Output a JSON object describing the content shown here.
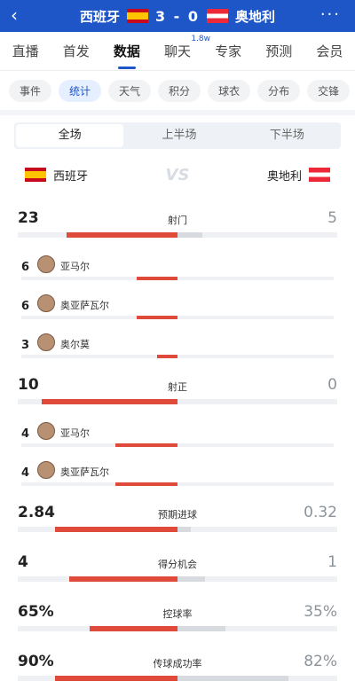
{
  "header": {
    "home_team": "西班牙",
    "away_team": "奥地利",
    "score": "3 - 0",
    "more": "···"
  },
  "tabs": [
    "直播",
    "首发",
    "数据",
    "聊天",
    "专家",
    "预测",
    "会员"
  ],
  "chat_badge": "1.8w",
  "chips": [
    "事件",
    "统计",
    "天气",
    "积分",
    "球衣",
    "分布",
    "交锋"
  ],
  "segments": [
    "全场",
    "上半场",
    "下半场"
  ],
  "teams": {
    "left": "西班牙",
    "right": "奥地利",
    "vs": "VS"
  },
  "stats": [
    {
      "label": "射门",
      "left": "23",
      "right": "5",
      "lpct": 0.82,
      "rpct": 0.18
    },
    {
      "label": "射正",
      "left": "10",
      "right": "0",
      "lpct": 1.0,
      "rpct": 0.0
    },
    {
      "label": "预期进球",
      "left": "2.84",
      "right": "0.32",
      "lpct": 0.9,
      "rpct": 0.1
    },
    {
      "label": "得分机会",
      "left": "4",
      "right": "1",
      "lpct": 0.8,
      "rpct": 0.2
    },
    {
      "label": "控球率",
      "left": "65%",
      "right": "35%",
      "lpct": 0.65,
      "rpct": 0.35
    },
    {
      "label": "传球成功率",
      "left": "90%",
      "right": "82%",
      "lpct": 0.9,
      "rpct": 0.82
    }
  ],
  "shot_players": [
    {
      "n": "6",
      "name": "亚马尔",
      "pct": 0.26
    },
    {
      "n": "6",
      "name": "奥亚萨瓦尔",
      "pct": 0.26
    },
    {
      "n": "3",
      "name": "奥尔莫",
      "pct": 0.13
    }
  ],
  "ontarget_players": [
    {
      "n": "4",
      "name": "亚马尔",
      "pct": 0.4
    },
    {
      "n": "4",
      "name": "奥亚萨瓦尔",
      "pct": 0.4
    }
  ],
  "colors": {
    "brand": "#1e56c8",
    "home": "#e04a3a",
    "away": "#d7dadf"
  }
}
